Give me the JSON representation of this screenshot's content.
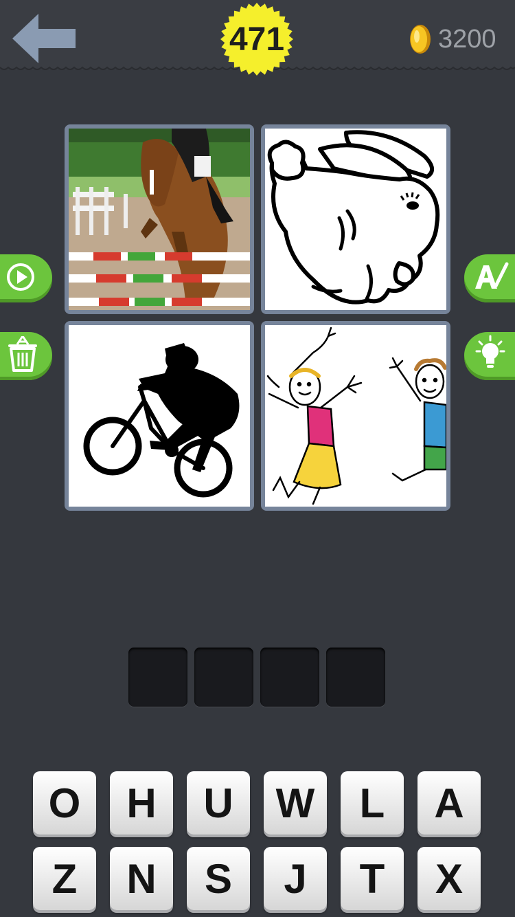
{
  "header": {
    "level": "471",
    "coins": "3200",
    "back_icon": "back-arrow-icon",
    "coin_icon": "gold-coin-icon",
    "badge_color": "#f5ef2c"
  },
  "pictures": [
    {
      "subject": "show-jumping-horse"
    },
    {
      "subject": "rabbit-drawing"
    },
    {
      "subject": "bmx-rider-silhouette"
    },
    {
      "subject": "jumping-kids-drawing"
    }
  ],
  "side_buttons": {
    "left": [
      "play-icon",
      "trash-icon"
    ],
    "right": [
      "magic-wand-icon",
      "lightbulb-icon"
    ],
    "color": "#6cc53d"
  },
  "answer": {
    "slots": [
      "",
      "",
      "",
      ""
    ]
  },
  "keyboard": {
    "row1": [
      "O",
      "H",
      "U",
      "W",
      "L",
      "A"
    ],
    "row2": [
      "Z",
      "N",
      "S",
      "J",
      "T",
      "X"
    ]
  }
}
